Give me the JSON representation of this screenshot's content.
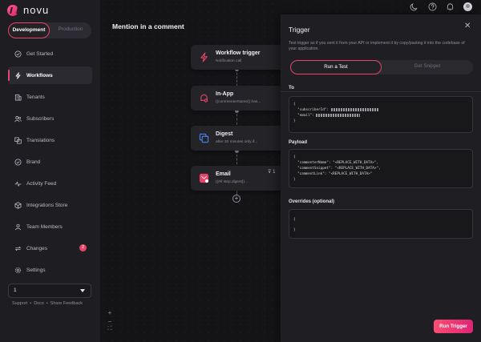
{
  "brand": {
    "name": "novu"
  },
  "environment": {
    "dev_label": "Development",
    "prod_label": "Production"
  },
  "sidebar": {
    "items": [
      {
        "label": "Get Started",
        "icon": "check-circle-icon"
      },
      {
        "label": "Workflows",
        "icon": "bolt-icon",
        "active": true
      },
      {
        "label": "Tenants",
        "icon": "building-icon"
      },
      {
        "label": "Subscribers",
        "icon": "users-icon"
      },
      {
        "label": "Translations",
        "icon": "translate-icon"
      },
      {
        "label": "Brand",
        "icon": "check-badge-icon"
      },
      {
        "label": "Activity Feed",
        "icon": "activity-icon"
      },
      {
        "label": "Integrations Store",
        "icon": "box-icon"
      },
      {
        "label": "Team Members",
        "icon": "team-icon"
      },
      {
        "label": "Changes",
        "icon": "sync-icon",
        "badge": "2"
      },
      {
        "label": "Settings",
        "icon": "gear-icon"
      }
    ],
    "org_select_value": "1",
    "footer": {
      "support": "Support",
      "sep1": "•",
      "docs": "Docs",
      "sep2": "•",
      "feedback": "Share Feedback"
    }
  },
  "canvas": {
    "title": "Mention in a comment",
    "nodes": [
      {
        "title": "Workflow trigger",
        "subtitle": "Notification call"
      },
      {
        "title": "In-App",
        "subtitle": "{{commenterName}} has..."
      },
      {
        "title": "Digest",
        "subtitle": "after 30 minutes only if..."
      },
      {
        "title": "Email",
        "subtitle": "{{#if step.digest}}..."
      }
    ],
    "filter_count": "1",
    "add_symbol": "+",
    "zoom": {
      "in": "+",
      "out": "−",
      "fit": "⛶"
    }
  },
  "trigger_panel": {
    "title": "Trigger",
    "close": "✕",
    "description": "Test trigger as if you sent it from your API or implement it by copy/pasting it into the codebase of your application.",
    "tabs": {
      "run": "Run a Test",
      "snippet": "Get Snippet"
    },
    "to_label": "To",
    "to_code": {
      "open": "{",
      "subscriber_key": "  \"subscriberId\": ",
      "email_key": "  \"email\": ",
      "close": "}"
    },
    "payload_label": "Payload",
    "payload_code": {
      "open": "{",
      "line1": "  \"commenterName\": \"<REPLACE_WITH_DATA>\",",
      "line2": "  \"commentSnippet\": \"<REPLACE_WITH_DATA>\",",
      "line3": "  \"commentLink\": \"<REPLACE_WITH_DATA>\"",
      "close": "}"
    },
    "overrides_label": "Overrides (optional)",
    "overrides_code": {
      "open": "{",
      "close": "}"
    },
    "run_button": "Run Trigger"
  },
  "colors": {
    "accent": "#e54568",
    "accent_gradient_end": "#dd2476",
    "background": "#161618",
    "panel": "#1f1f23"
  }
}
